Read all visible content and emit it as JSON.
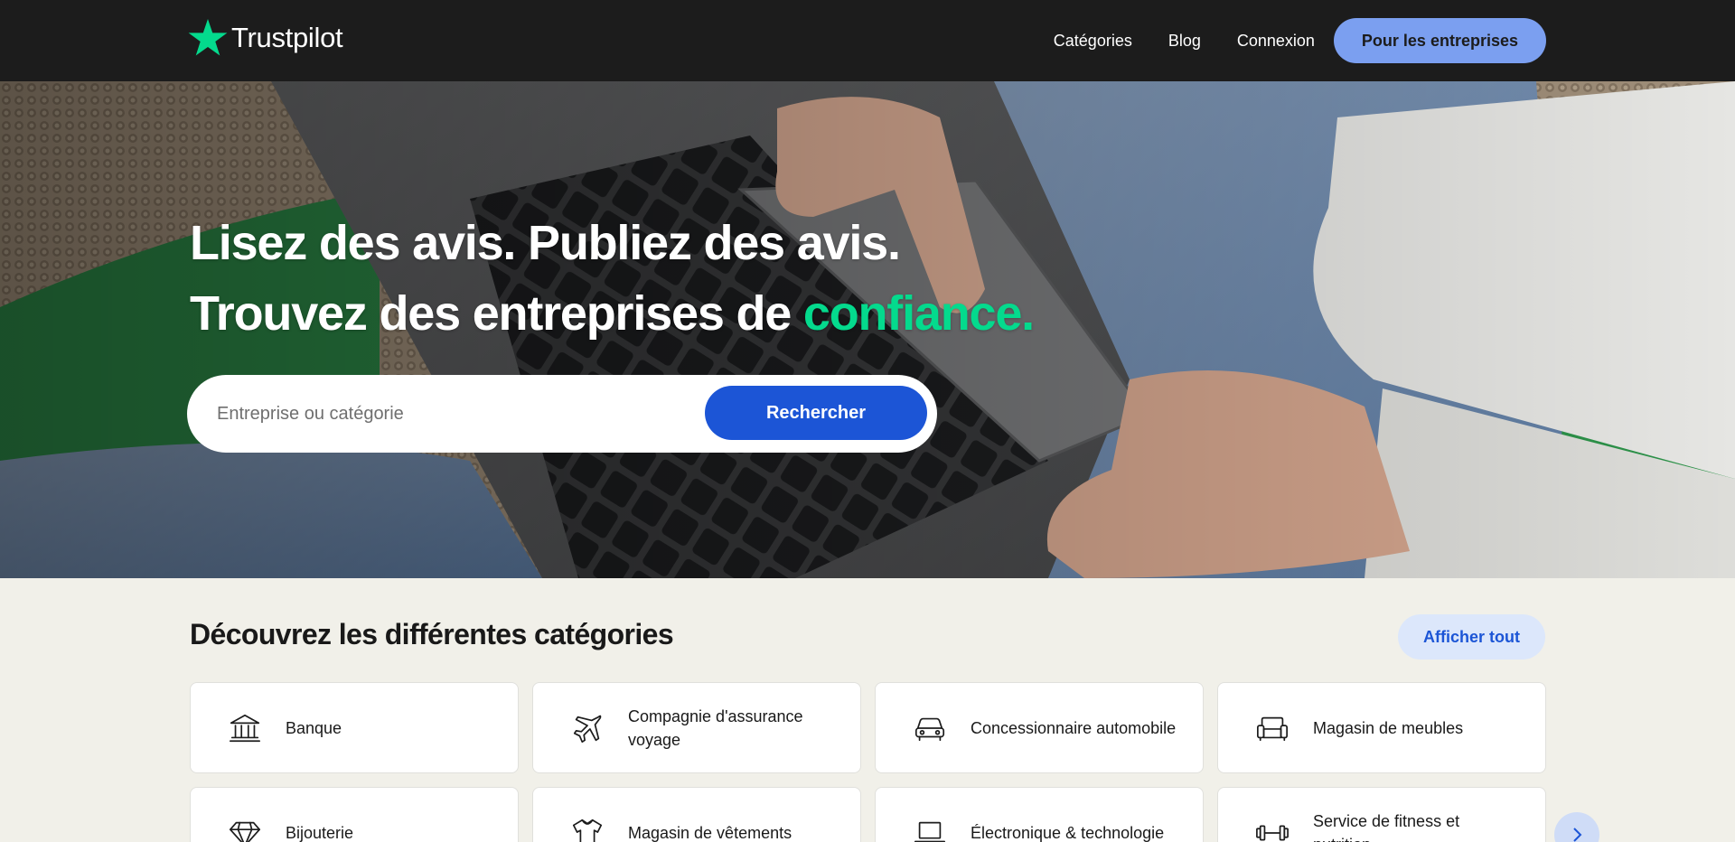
{
  "header": {
    "brand": "Trustpilot",
    "nav": [
      {
        "label": "Catégories"
      },
      {
        "label": "Blog"
      },
      {
        "label": "Connexion"
      }
    ],
    "cta_label": "Pour les entreprises"
  },
  "hero": {
    "line1": "Lisez des avis. Publiez des avis.",
    "line2_start": "Trouvez des entreprises de ",
    "line2_accent": "confiance.",
    "search_placeholder": "Entreprise ou catégorie",
    "search_value": "",
    "search_button": "Rechercher"
  },
  "categories": {
    "title": "Découvrez les différentes catégories",
    "show_all": "Afficher tout",
    "items": [
      {
        "label": "Banque",
        "icon": "bank-icon"
      },
      {
        "label": "Compagnie d'assurance voyage",
        "icon": "airplane-icon"
      },
      {
        "label": "Concessionnaire automobile",
        "icon": "car-icon"
      },
      {
        "label": "Magasin de meubles",
        "icon": "sofa-icon"
      },
      {
        "label": "Bijouterie",
        "icon": "diamond-icon"
      },
      {
        "label": "Magasin de vêtements",
        "icon": "shirt-icon"
      },
      {
        "label": "Électronique & technologie",
        "icon": "laptop-icon"
      },
      {
        "label": "Service de fitness et nutrition",
        "icon": "dumbbell-icon"
      }
    ]
  },
  "colors": {
    "header_bg": "#1c1c1c",
    "brand_green": "#04da8d",
    "primary_blue": "#1c55d6",
    "cta_blue": "#7b9ff0",
    "page_bg": "#f1f0e9"
  }
}
